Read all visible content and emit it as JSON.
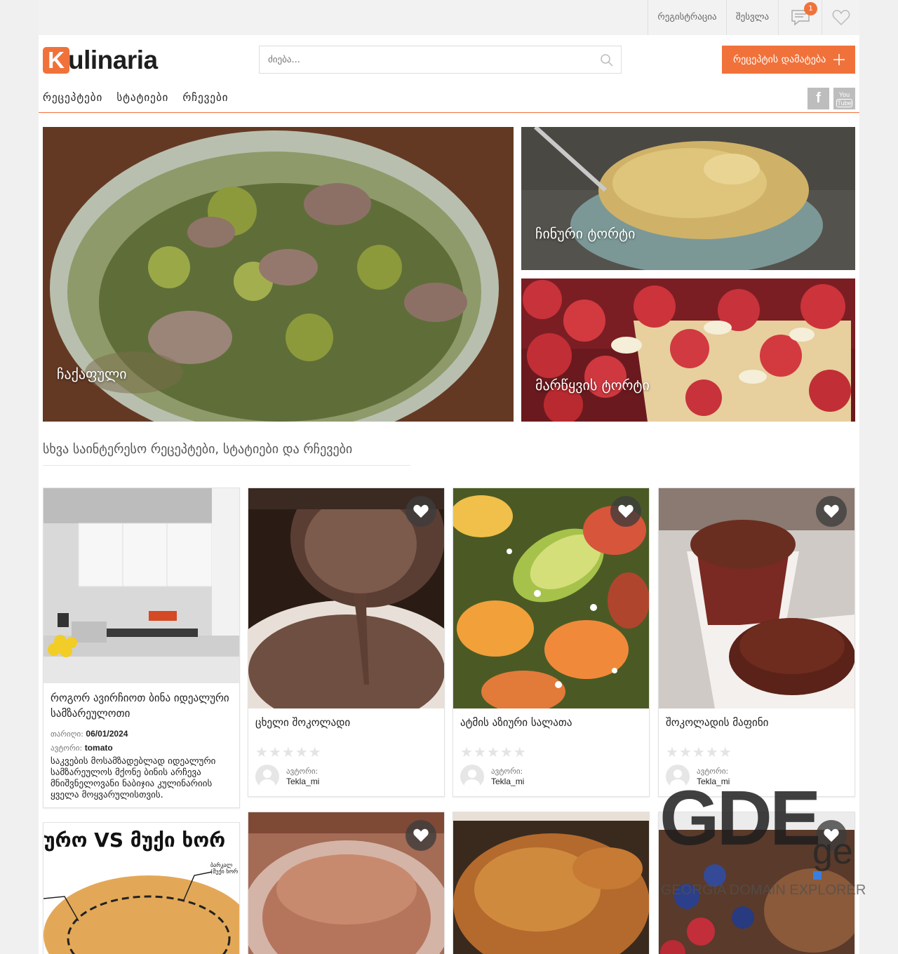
{
  "topbar": {
    "register": "რეგისტრაცია",
    "login": "შესვლა",
    "messages_badge": "1"
  },
  "logo": {
    "first_letter": "K",
    "rest": "ulinaria"
  },
  "search": {
    "placeholder": "ძიება..."
  },
  "add_recipe_label": "რეცეპტის დამატება",
  "nav": [
    "რეცეპტები",
    "სტატიები",
    "რჩევები"
  ],
  "social": {
    "facebook": "f",
    "youtube_top": "You",
    "youtube_bottom": "Tube"
  },
  "hero": [
    {
      "caption": "ჩაქაფული"
    },
    {
      "caption": "ჩინური ტორტი"
    },
    {
      "caption": "მარწყვის ტორტი"
    }
  ],
  "section_title": "სხვა საინტერესო რეცეპტები, სტატიები და რჩევები",
  "article_card": {
    "title": "როგორ ავირჩიოთ ბინა იდეალური სამზარეულოთი",
    "date_label": "თარიღი:",
    "date": "06/01/2024",
    "author_label": "ავტორი:",
    "author": "tomato",
    "description": "საკვების მოსამზადებლად იდეალური სამზარეულოს მქონე ბინის არჩევა მნიშვნელოვანი ნაბიჯია კულინარიის ყველა მოყვარულისთვის."
  },
  "recipe_cards": [
    {
      "title": "ცხელი შოკოლადი",
      "author_label": "ავტორი:",
      "author": "Tekla_mi",
      "rating": 0
    },
    {
      "title": "ატმის აზიური სალათა",
      "author_label": "ავტორი:",
      "author": "Tekla_mi",
      "rating": 0
    },
    {
      "title": "შოკოლადის მაფინი",
      "author_label": "ავტორი:",
      "author": "Tekla_mi",
      "rating": 0
    }
  ],
  "bottom_card_text": "ურო VS მუქი ხორ",
  "bottom_card_labels": [
    "ბარკალ",
    "(მუქი ხორ"
  ],
  "watermark": {
    "main": "GDE",
    "tld": "ge",
    "sub": "GEORGIA DOMAIN EXPLORER"
  },
  "colors": {
    "accent": "#f0723a",
    "text": "#222222"
  },
  "icons": [
    "search-icon",
    "plus-icon",
    "message-icon",
    "heart-icon",
    "facebook-icon",
    "youtube-icon",
    "star-icon",
    "user-avatar-icon"
  ]
}
